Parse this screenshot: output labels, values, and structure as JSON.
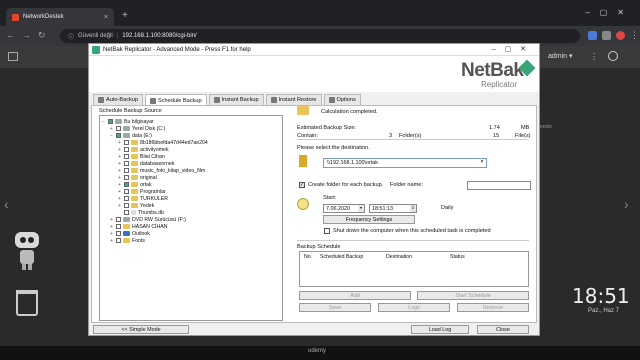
{
  "browser": {
    "tab_title": "NetworkDestek",
    "tab_close": "×",
    "new_tab": "+",
    "security_label": "Güvenli değil",
    "url": "192.168.1.100:8080/cgi-bin/"
  },
  "desktop": {
    "user": "admin ▾",
    "clock": "18:51",
    "date": "Paz., Haz 7",
    "side_text": "enzio",
    "watermark": "udemy"
  },
  "window": {
    "title": "NetBak Replicator - Advanced Mode - Press F1 for help",
    "logo_main": "NetBak",
    "logo_sub": "Replicator",
    "tabs": [
      {
        "label": "Auto-Backup"
      },
      {
        "label": "Schedule Backup"
      },
      {
        "label": "Instant Backup"
      },
      {
        "label": "Instant Restore"
      },
      {
        "label": "Options"
      }
    ],
    "source_label": "Schedule Backup Source",
    "tree": [
      {
        "label": "Bu bilgisayar",
        "checked": true
      },
      {
        "label": "Yerel Disk (C:)"
      },
      {
        "label": "data (E:)"
      },
      {
        "label": "8b186bbefda47d44ed7ae204"
      },
      {
        "label": "activityomek"
      },
      {
        "label": "Bilal Cihan"
      },
      {
        "label": "databaseornek"
      },
      {
        "label": "music_foto_kitap_video_film"
      },
      {
        "label": "original"
      },
      {
        "label": "ortak"
      },
      {
        "label": "Programlar"
      },
      {
        "label": "TURKULER"
      },
      {
        "label": "Yedek"
      },
      {
        "label": "Thumbs.db"
      },
      {
        "label": "DVD RW Sürücüsü (F:)"
      },
      {
        "label": "HASAN CİHAN"
      },
      {
        "label": "Outlook"
      },
      {
        "label": "Fonts"
      }
    ],
    "calc_status": "Calculation completed.",
    "est_size_label": "Estimated Backup Size:",
    "est_size_value": "1.74",
    "est_size_unit": "MB",
    "contain_label": "Contain:",
    "folders_count": "3",
    "folders_label": "Folder(s)",
    "files_count": "15",
    "files_label": "File(s)",
    "dest_label": "Please select the destination.",
    "dest_value": "\\\\192.168.1.100\\ortak",
    "create_folder_label": "Create folder for each backup.",
    "folder_name_label": "Folder name:",
    "start_label": "Start:",
    "start_date": "7.06.2020",
    "start_time": "18:51:13",
    "repeat": "Daily",
    "frequency_btn": "Frequency Settings",
    "shutdown_label": "Shut down the computer when this scheduled task is completed",
    "schedule_label": "Backup Schedule",
    "columns": [
      "No.",
      "Scheduled Backup",
      "Destination",
      "Status"
    ],
    "add_btn": "Add",
    "start_backup_btn": "Start Schedule",
    "save_btn": "Save",
    "logs_btn": "Logs",
    "remove_btn": "Remove",
    "simple_mode_btn": "<< Simple Mode",
    "load_log_btn": "Load Log",
    "close_btn": "Close"
  }
}
